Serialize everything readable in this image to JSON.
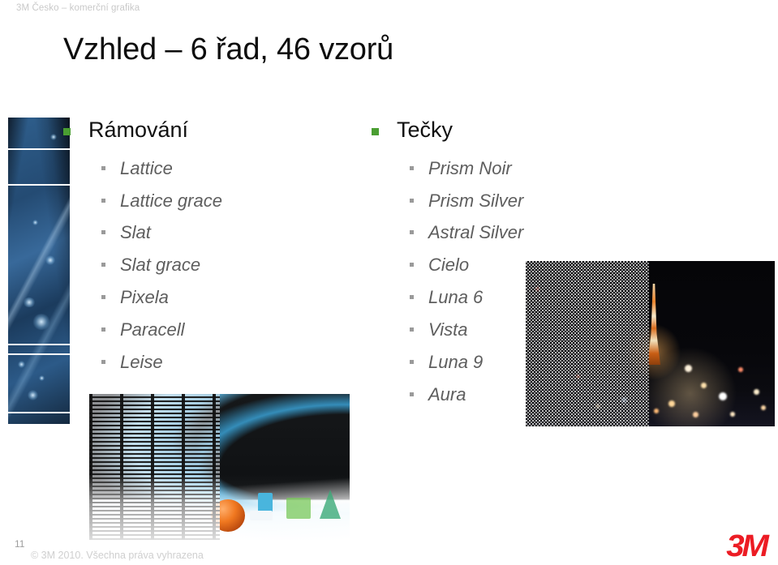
{
  "header": {
    "text": "3M Česko – komerční grafika"
  },
  "title": "Vzhled – 6 řad, 46 vzorů",
  "columns": [
    {
      "id": "framing",
      "heading": "Rámování",
      "bullet_color": "#4a9e32",
      "items": [
        "Lattice",
        "Lattice grace",
        "Slat",
        "Slat grace",
        "Pixela",
        "Paracell",
        "Leise"
      ]
    },
    {
      "id": "dots",
      "heading": "Tečky",
      "bullet_color": "#4a9e32",
      "items": [
        "Prism Noir",
        "Prism Silver",
        "Astral Silver",
        "Cielo",
        "Luna 6",
        "Vista",
        "Luna 9",
        "Aura"
      ]
    }
  ],
  "images": {
    "left_strip": "blue-abstract-banded-strip",
    "lattice_sample": "lattice-film-over-studio-still-life",
    "dots_sample": "dot-film-over-night-cityscape"
  },
  "footer": {
    "page_number": "11",
    "copyright": "© 3M 2010. Všechna práva vyhrazena",
    "logo": "3M"
  },
  "colors": {
    "accent_green": "#4a9e32",
    "brand_red": "#ec1c24",
    "title_text": "#0d0d0d",
    "subitem_text": "#5e5e5e",
    "muted_gray": "#cfcfcf"
  }
}
